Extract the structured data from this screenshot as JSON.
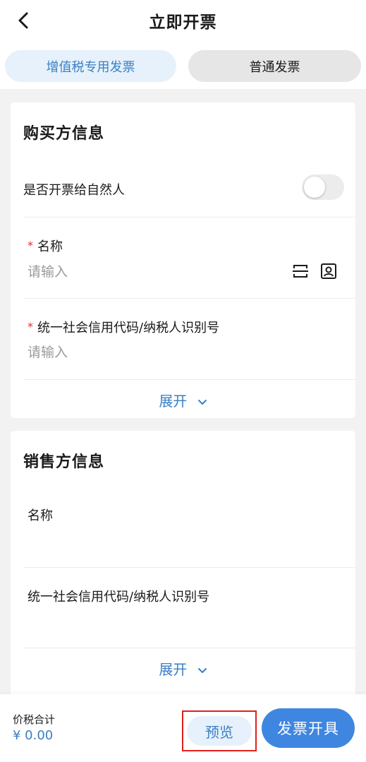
{
  "header": {
    "title": "立即开票"
  },
  "tabs": [
    {
      "label": "增值税专用发票",
      "active": true
    },
    {
      "label": "普通发票",
      "active": false
    }
  ],
  "buyer": {
    "section_title": "购买方信息",
    "natural_person_label": "是否开票给自然人",
    "natural_person_on": false,
    "name_label": "名称",
    "name_placeholder": "请输入",
    "tax_id_label": "统一社会信用代码/纳税人识别号",
    "tax_id_placeholder": "请输入",
    "expand_label": "展开",
    "required_mark": "*"
  },
  "seller": {
    "section_title": "销售方信息",
    "name_label": "名称",
    "tax_id_label": "统一社会信用代码/纳税人识别号",
    "expand_label": "展开"
  },
  "footer": {
    "total_label": "价税合计",
    "total_value": "¥ 0.00",
    "preview_label": "预览",
    "issue_label": "发票开具"
  },
  "colors": {
    "accent": "#3a7fc4",
    "primary_button": "#3f86e0",
    "required": "#e0312b",
    "highlight_box": "#e02020"
  }
}
